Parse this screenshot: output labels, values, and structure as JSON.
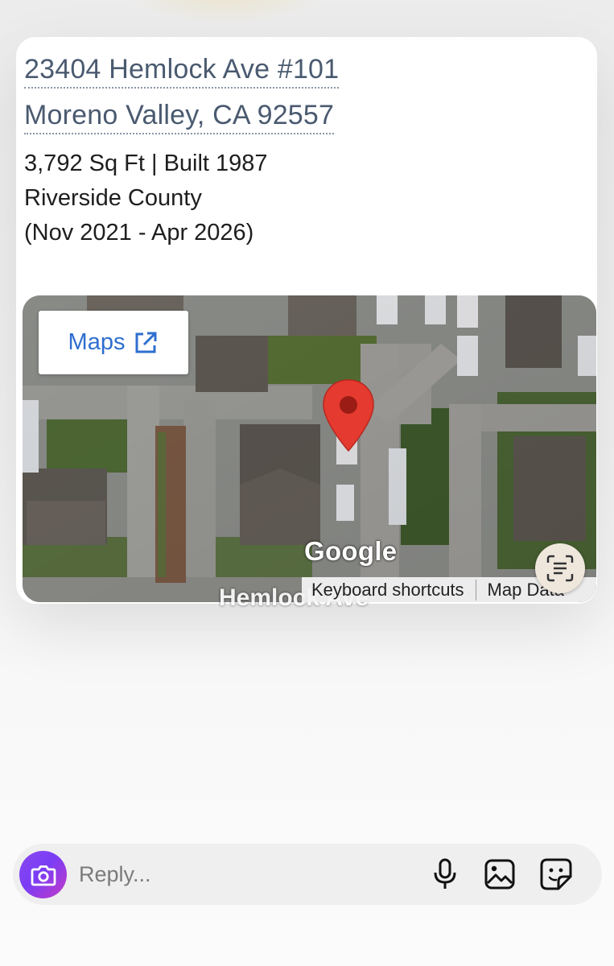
{
  "listing": {
    "address_line1": "23404 Hemlock Ave #101",
    "address_line2": "Moreno Valley, CA 92557",
    "details": "3,792 Sq Ft | Built 1987",
    "county": "Riverside County",
    "date_range": "(Nov 2021 - Apr 2026)"
  },
  "map": {
    "maps_button_label": "Maps",
    "provider_logo": "Google",
    "street_label": "Hemlock Ave",
    "keyboard_shortcuts": "Keyboard shortcuts",
    "map_data": "Map Data",
    "pin_color": "#e53a2f"
  },
  "reply_bar": {
    "placeholder": "Reply...",
    "icons": [
      "camera-icon",
      "microphone-icon",
      "image-icon",
      "sticker-icon"
    ],
    "accent": "#8a49f0"
  }
}
